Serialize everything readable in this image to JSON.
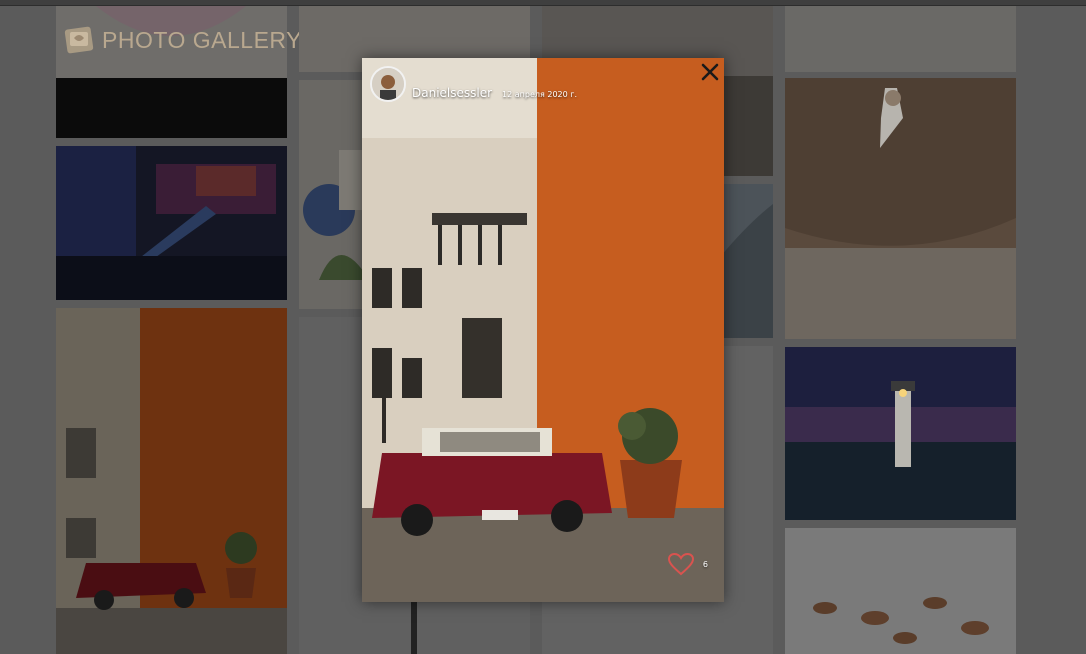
{
  "app": {
    "logo_text": "PHOTO GALLERY"
  },
  "gallery": {
    "tiles": [
      {
        "name": "tile-logo-top"
      },
      {
        "name": "tile-neon-staircase"
      },
      {
        "name": "tile-orange-wall-car"
      },
      {
        "name": "tile-sign-blue"
      },
      {
        "name": "tile-col2-bottom"
      },
      {
        "name": "tile-col3-top"
      },
      {
        "name": "tile-col3-mid"
      },
      {
        "name": "tile-col3-bottom"
      },
      {
        "name": "tile-climber-rock"
      },
      {
        "name": "tile-lighthouse-night"
      },
      {
        "name": "tile-pebbles"
      }
    ]
  },
  "modal": {
    "author": "Danielsessler",
    "date": "12 апреля 2020 г.",
    "likes": "6",
    "close_icon": "close-icon",
    "like_icon": "heart-icon",
    "accent": "#d2692a"
  }
}
